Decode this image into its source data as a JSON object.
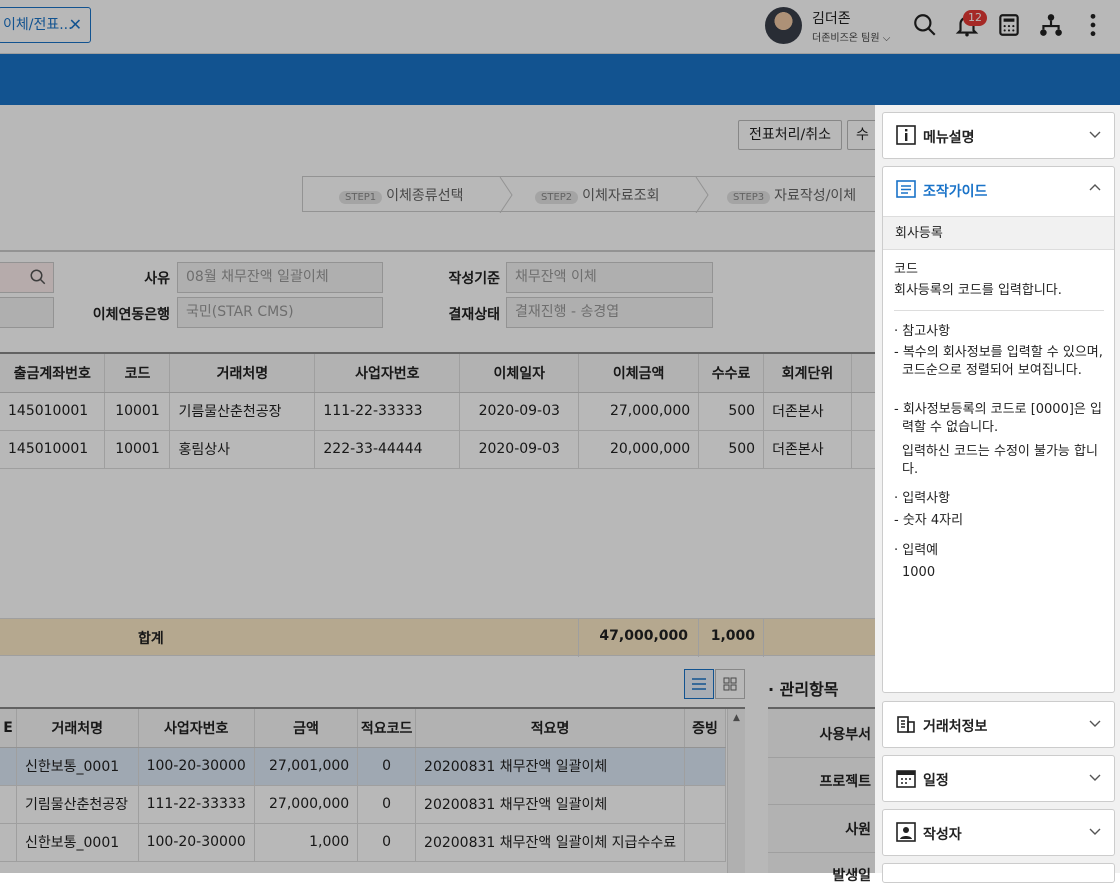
{
  "topbar": {
    "tab_label": "이체/전표...",
    "user_name": "김더존",
    "user_team": "더존비즈온 팀원",
    "notif_count": "12",
    "icons": [
      "search-icon",
      "bell-icon",
      "calculator-icon",
      "org-chart-icon",
      "more-icon"
    ]
  },
  "toolbar": {
    "btn_voucher": "전표처리/취소",
    "btn_edit": "수"
  },
  "steps": [
    {
      "pill": "STEP1",
      "label": "이체종류선택"
    },
    {
      "pill": "STEP2",
      "label": "이체자료조회"
    },
    {
      "pill": "STEP3",
      "label": "자료작성/이체"
    }
  ],
  "form": {
    "reason_label": "사유",
    "reason_value": "08월 채무잔액 일괄이체",
    "bank_label": "이체연동은행",
    "bank_value": "국민(STAR CMS)",
    "basis_label": "작성기준",
    "basis_value": "채무잔액 이체",
    "approval_label": "결재상태",
    "approval_value": "결재진행 - 송경엽"
  },
  "main_table": {
    "headers": [
      "출금계좌번호",
      "코드",
      "거래처명",
      "사업자번호",
      "이체일자",
      "이체금액",
      "수수료",
      "회계단위"
    ],
    "rows": [
      [
        "145010001",
        "10001",
        "기름물산춘천공장",
        "111-22-33333",
        "2020-09-03",
        "27,000,000",
        "500",
        "더존본사"
      ],
      [
        "145010001",
        "10001",
        "홍림상사",
        "222-33-44444",
        "2020-09-03",
        "20,000,000",
        "500",
        "더존본사"
      ]
    ],
    "sum_label": "합계",
    "sum_amount": "47,000,000",
    "sum_fee": "1,000"
  },
  "detail_table": {
    "headers": [
      "E",
      "거래처명",
      "사업자번호",
      "금액",
      "적요코드",
      "적요명",
      "증빙"
    ],
    "rows": [
      [
        "신한보통_0001",
        "100-20-30000",
        "27,001,000",
        "0",
        "20200831 채무잔액 일괄이체"
      ],
      [
        "기림물산춘천공장",
        "111-22-33333",
        "27,000,000",
        "0",
        "20200831 채무잔액 일괄이체"
      ],
      [
        "신한보통_0001",
        "100-20-30000",
        "1,000",
        "0",
        "20200831 채무잔액 일괄이체 지급수수료"
      ]
    ]
  },
  "mgmt": {
    "title": "· 관리항목",
    "labels": [
      "사용부서",
      "프로젝트",
      "사원",
      "발생일"
    ]
  },
  "panel": {
    "menu_desc": "메뉴설명",
    "guide_title": "조작가이드",
    "guide_section": "회사등록",
    "code_title": "코드",
    "code_desc": "회사등록의 코드를 입력합니다.",
    "ref_title": "참고사항",
    "ref_1": "복수의 회사정보를 입력할 수 있으며, 코드순으로 정렬되어 보여집니다.",
    "ref_2": "회사정보등록의 코드로 [0000]은 입력할 수 없습니다.",
    "ref_3": "입력하신 코드는 수정이 불가능 합니다.",
    "input_title": "입력사항",
    "input_1": "숫자 4자리",
    "example_title": "입력예",
    "example_value": "1000",
    "client_info": "거래처정보",
    "schedule": "일정",
    "author": "작성자"
  },
  "colors": {
    "accent": "#1a73c8",
    "sum_bg": "#fbe9c7",
    "badge": "#e53935"
  }
}
